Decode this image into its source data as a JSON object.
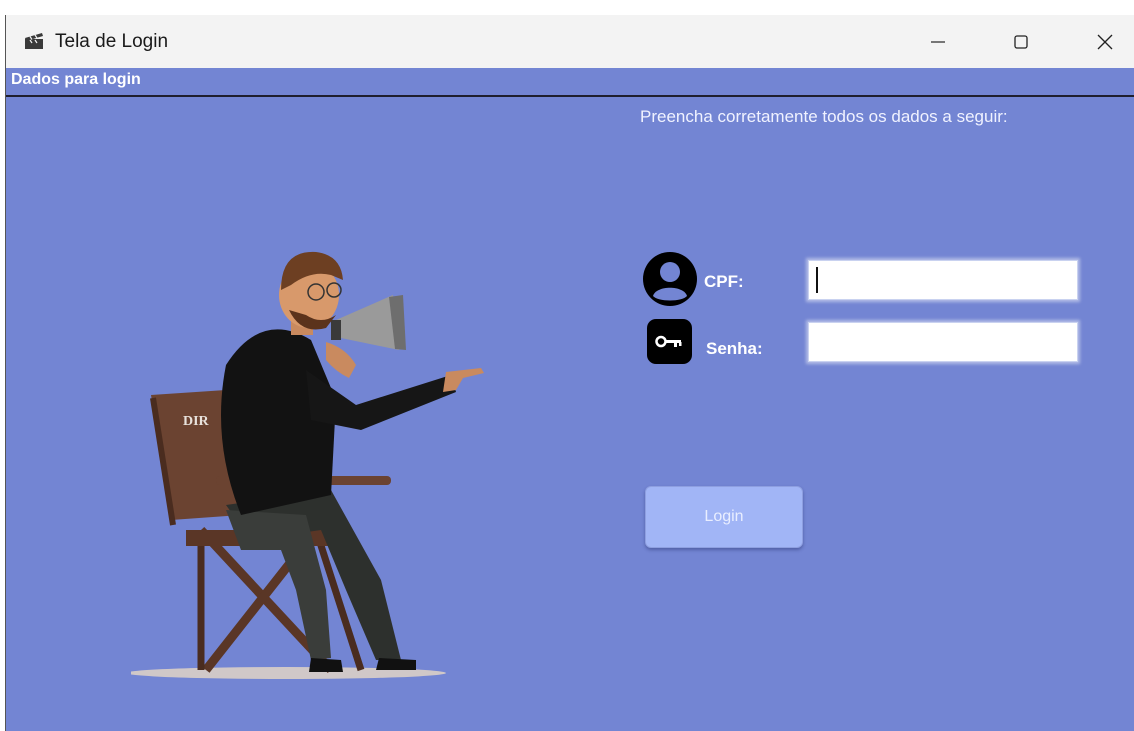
{
  "window": {
    "title": "Tela de Login",
    "controls": [
      "minimize",
      "maximize",
      "close"
    ]
  },
  "menubar": {
    "label": "Dados para login"
  },
  "form": {
    "instructions": "Preencha corretamente todos os dados a seguir:",
    "cpf": {
      "label": "CPF:",
      "value": "",
      "icon": "user-avatar-icon"
    },
    "senha": {
      "label": "Senha:",
      "value": "",
      "icon": "key-icon"
    },
    "login_button": "Login"
  },
  "illustration": {
    "chair_text": "DIR"
  },
  "colors": {
    "background": "#7385d3",
    "titlebar": "#f3f3f3",
    "button": "#a1b5f6",
    "text": "#ffffff"
  }
}
